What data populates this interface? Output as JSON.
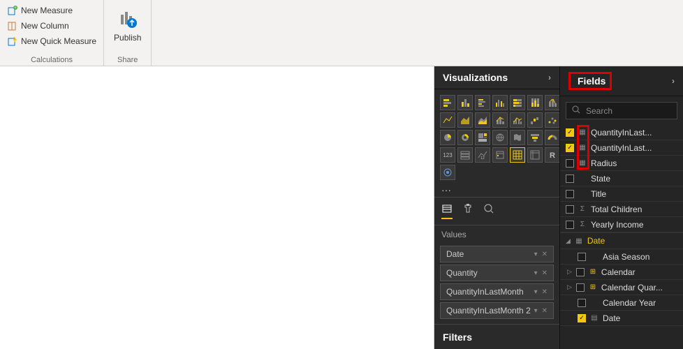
{
  "ribbon": {
    "calculations": {
      "new_measure": "New Measure",
      "new_column": "New Column",
      "new_quick_measure": "New Quick Measure",
      "group_label": "Calculations"
    },
    "share": {
      "publish": "Publish",
      "group_label": "Share"
    }
  },
  "panes": {
    "visualizations": "Visualizations",
    "fields": "Fields"
  },
  "viz": {
    "values_label": "Values",
    "wells": [
      "Date",
      "Quantity",
      "QuantityInLastMonth",
      "QuantityInLastMonth 2"
    ],
    "filters_label": "Filters",
    "more": "···"
  },
  "search": {
    "placeholder": "Search"
  },
  "fields": {
    "top": [
      {
        "label": "QuantityInLast...",
        "checked": true,
        "icon": "col"
      },
      {
        "label": "QuantityInLast...",
        "checked": true,
        "icon": "col"
      },
      {
        "label": "Radius",
        "checked": false,
        "icon": "col"
      },
      {
        "label": "State",
        "checked": false,
        "icon": ""
      },
      {
        "label": "Title",
        "checked": false,
        "icon": ""
      },
      {
        "label": "Total Children",
        "checked": false,
        "icon": "sigma"
      },
      {
        "label": "Yearly Income",
        "checked": false,
        "icon": "sigma"
      }
    ],
    "table_name": "Date",
    "table_items": [
      {
        "label": "Asia Season",
        "checked": false,
        "icon": "",
        "expand": false
      },
      {
        "label": "Calendar",
        "checked": false,
        "icon": "hier",
        "expand": true
      },
      {
        "label": "Calendar Quar...",
        "checked": false,
        "icon": "hier",
        "expand": true
      },
      {
        "label": "Calendar Year",
        "checked": false,
        "icon": "",
        "expand": false
      },
      {
        "label": "Date",
        "checked": true,
        "icon": "table",
        "expand": false
      }
    ]
  }
}
